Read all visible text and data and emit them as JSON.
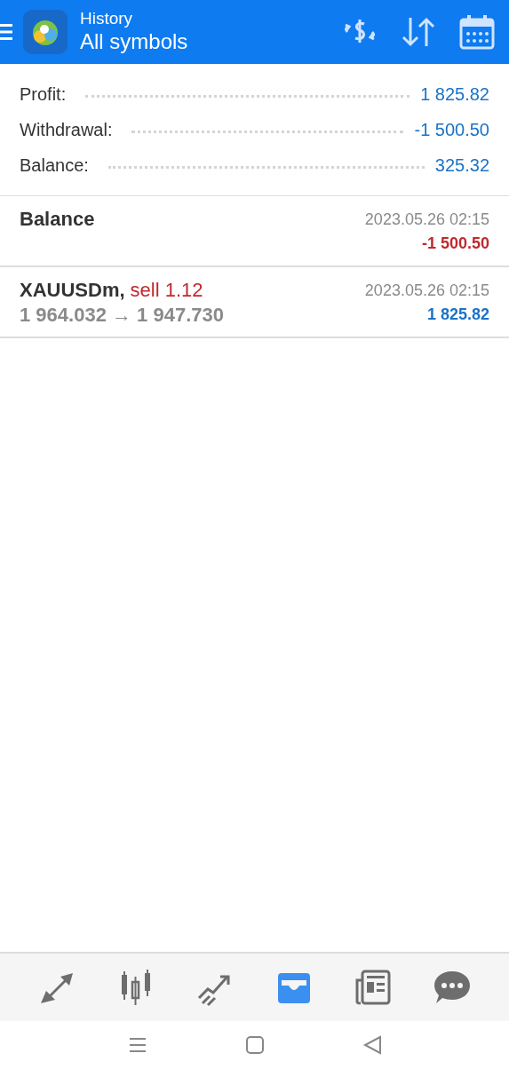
{
  "header": {
    "title": "History",
    "subtitle": "All symbols"
  },
  "summary": [
    {
      "label": "Profit:",
      "value": "1 825.82"
    },
    {
      "label": "Withdrawal:",
      "value": "-1 500.50"
    },
    {
      "label": "Balance:",
      "value": "325.32"
    }
  ],
  "deals": [
    {
      "kind": "balance",
      "title": "Balance",
      "time": "2023.05.26 02:15",
      "amount": "-1 500.50",
      "negative": true
    },
    {
      "kind": "trade",
      "title": "XAUUSDm,",
      "action": "sell 1.12",
      "prices": "1 964.032 → 1 947.730",
      "time": "2023.05.26 02:15",
      "amount": "1 825.82",
      "negative": false
    }
  ],
  "bottom_tabs": [
    {
      "selected": false
    },
    {
      "selected": false
    },
    {
      "selected": false
    },
    {
      "selected": true
    },
    {
      "selected": false
    },
    {
      "selected": false
    }
  ]
}
